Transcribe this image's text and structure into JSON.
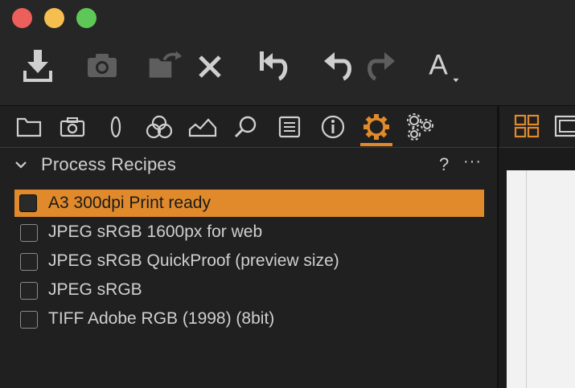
{
  "window": {
    "controls": [
      "close",
      "minimize",
      "maximize"
    ]
  },
  "toolbar": {
    "buttons": [
      {
        "name": "import-icon",
        "enabled": true
      },
      {
        "name": "camera-icon",
        "enabled": false
      },
      {
        "name": "move-to-icon",
        "enabled": false
      },
      {
        "name": "delete-x-icon",
        "enabled": true
      },
      {
        "name": "reset-icon",
        "enabled": true
      },
      {
        "name": "undo-icon",
        "enabled": true
      },
      {
        "name": "redo-icon",
        "enabled": false
      },
      {
        "name": "text-a-icon",
        "label": "A",
        "enabled": true
      }
    ]
  },
  "tabs": [
    {
      "name": "library-icon",
      "active": false
    },
    {
      "name": "capture-icon",
      "active": false
    },
    {
      "name": "lens-icon",
      "active": false
    },
    {
      "name": "color-icon",
      "active": false
    },
    {
      "name": "exposure-icon",
      "active": false
    },
    {
      "name": "details-icon",
      "active": false
    },
    {
      "name": "adjustments-icon",
      "active": false
    },
    {
      "name": "metadata-icon",
      "active": false
    },
    {
      "name": "output-icon",
      "active": true
    },
    {
      "name": "batch-icon",
      "active": false
    }
  ],
  "panel": {
    "title": "Process Recipes",
    "help_label": "?",
    "more_label": "···",
    "recipes": [
      {
        "label": "A3 300dpi Print ready",
        "checked": false,
        "selected": true
      },
      {
        "label": "JPEG sRGB 1600px for web",
        "checked": false,
        "selected": false
      },
      {
        "label": "JPEG sRGB QuickProof (preview size)",
        "checked": false,
        "selected": false
      },
      {
        "label": "JPEG sRGB",
        "checked": false,
        "selected": false
      },
      {
        "label": "TIFF Adobe RGB (1998) (8bit)",
        "checked": false,
        "selected": false
      }
    ]
  },
  "viewer": {
    "buttons": [
      "grid-view-icon",
      "single-view-icon"
    ]
  },
  "colors": {
    "accent": "#e08a2c",
    "background": "#202020",
    "text": "#cfcfcf",
    "disabled": "#5e5e5e"
  }
}
